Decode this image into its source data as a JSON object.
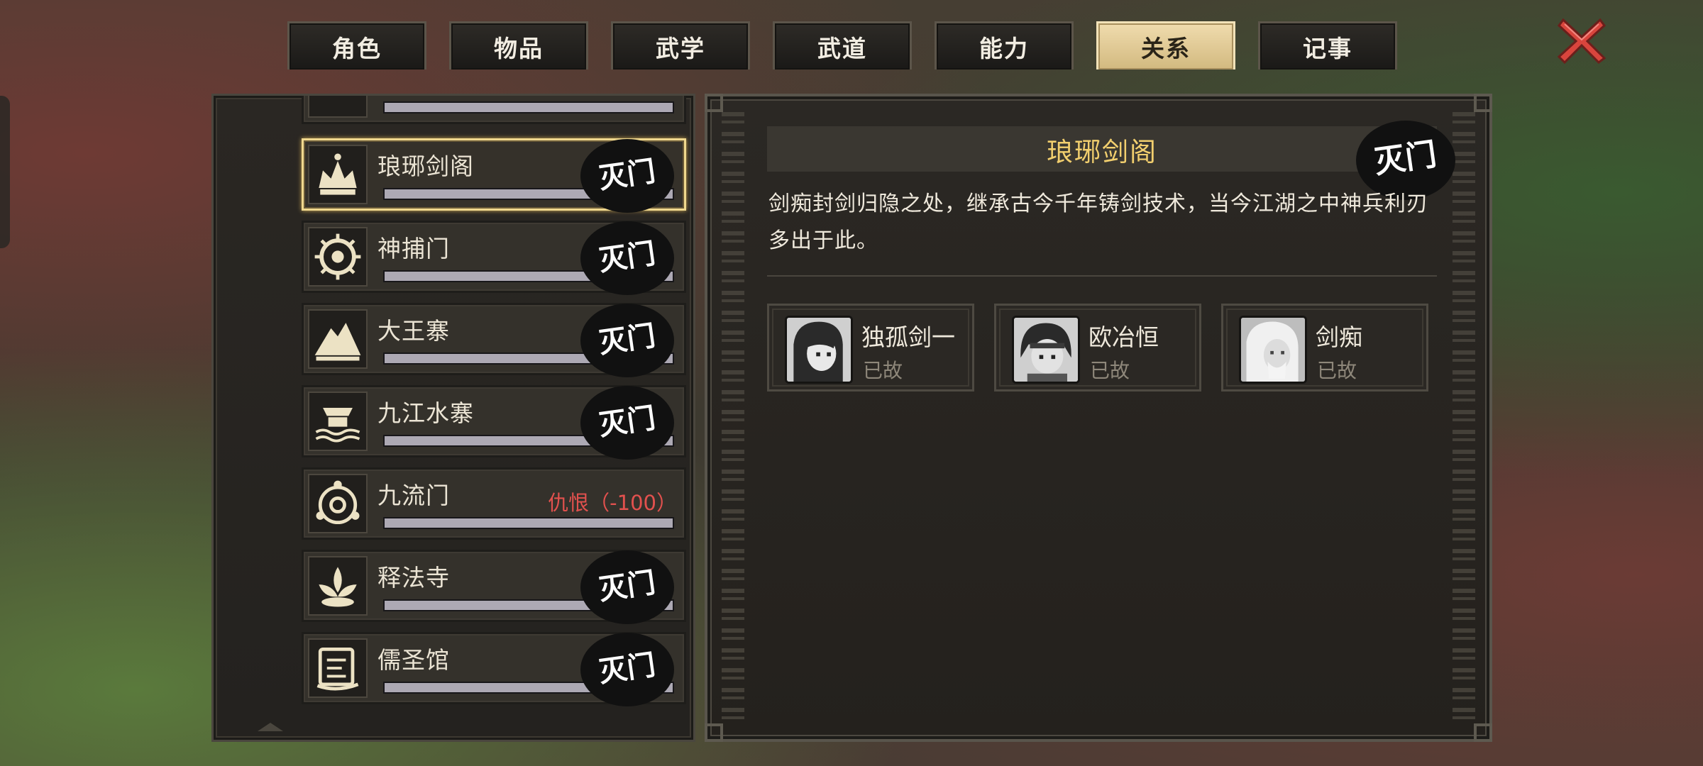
{
  "tabs": [
    "角色",
    "物品",
    "武学",
    "武道",
    "能力",
    "关系",
    "记事"
  ],
  "active_tab": "关系",
  "close_icon": "close-x-icon",
  "sects": [
    {
      "name": "琅琊剑阁",
      "icon": "crown-icon",
      "status": "",
      "destroyed": true,
      "selected": true
    },
    {
      "name": "神捕门",
      "icon": "eye-emblem-icon",
      "status": "",
      "destroyed": true,
      "selected": false
    },
    {
      "name": "大王寨",
      "icon": "mountain-icon",
      "status": "",
      "destroyed": true,
      "selected": false
    },
    {
      "name": "九江水寨",
      "icon": "water-fort-icon",
      "status": "",
      "destroyed": true,
      "selected": false
    },
    {
      "name": "九流门",
      "icon": "spiral-emblem-icon",
      "status": "仇恨（-100）",
      "destroyed": false,
      "selected": false
    },
    {
      "name": "释法寺",
      "icon": "lotus-icon",
      "status": "",
      "destroyed": true,
      "selected": false
    },
    {
      "name": "儒圣馆",
      "icon": "scroll-icon",
      "status": "",
      "destroyed": true,
      "selected": false
    }
  ],
  "stamp_text": "灭门",
  "detail": {
    "title": "琅琊剑阁",
    "description": "剑痴封剑归隐之处，继承古今千年铸剑技术，当今江湖之中神兵利刃多出于此。",
    "members": [
      {
        "name": "独孤剑一",
        "status": "已故"
      },
      {
        "name": "欧冶恒",
        "status": "已故"
      },
      {
        "name": "剑痴",
        "status": "已故"
      }
    ]
  },
  "colors": {
    "accent_gold": "#f2cf6e",
    "hatred_red": "#e2514e",
    "active_tab": "#e6cf98"
  }
}
